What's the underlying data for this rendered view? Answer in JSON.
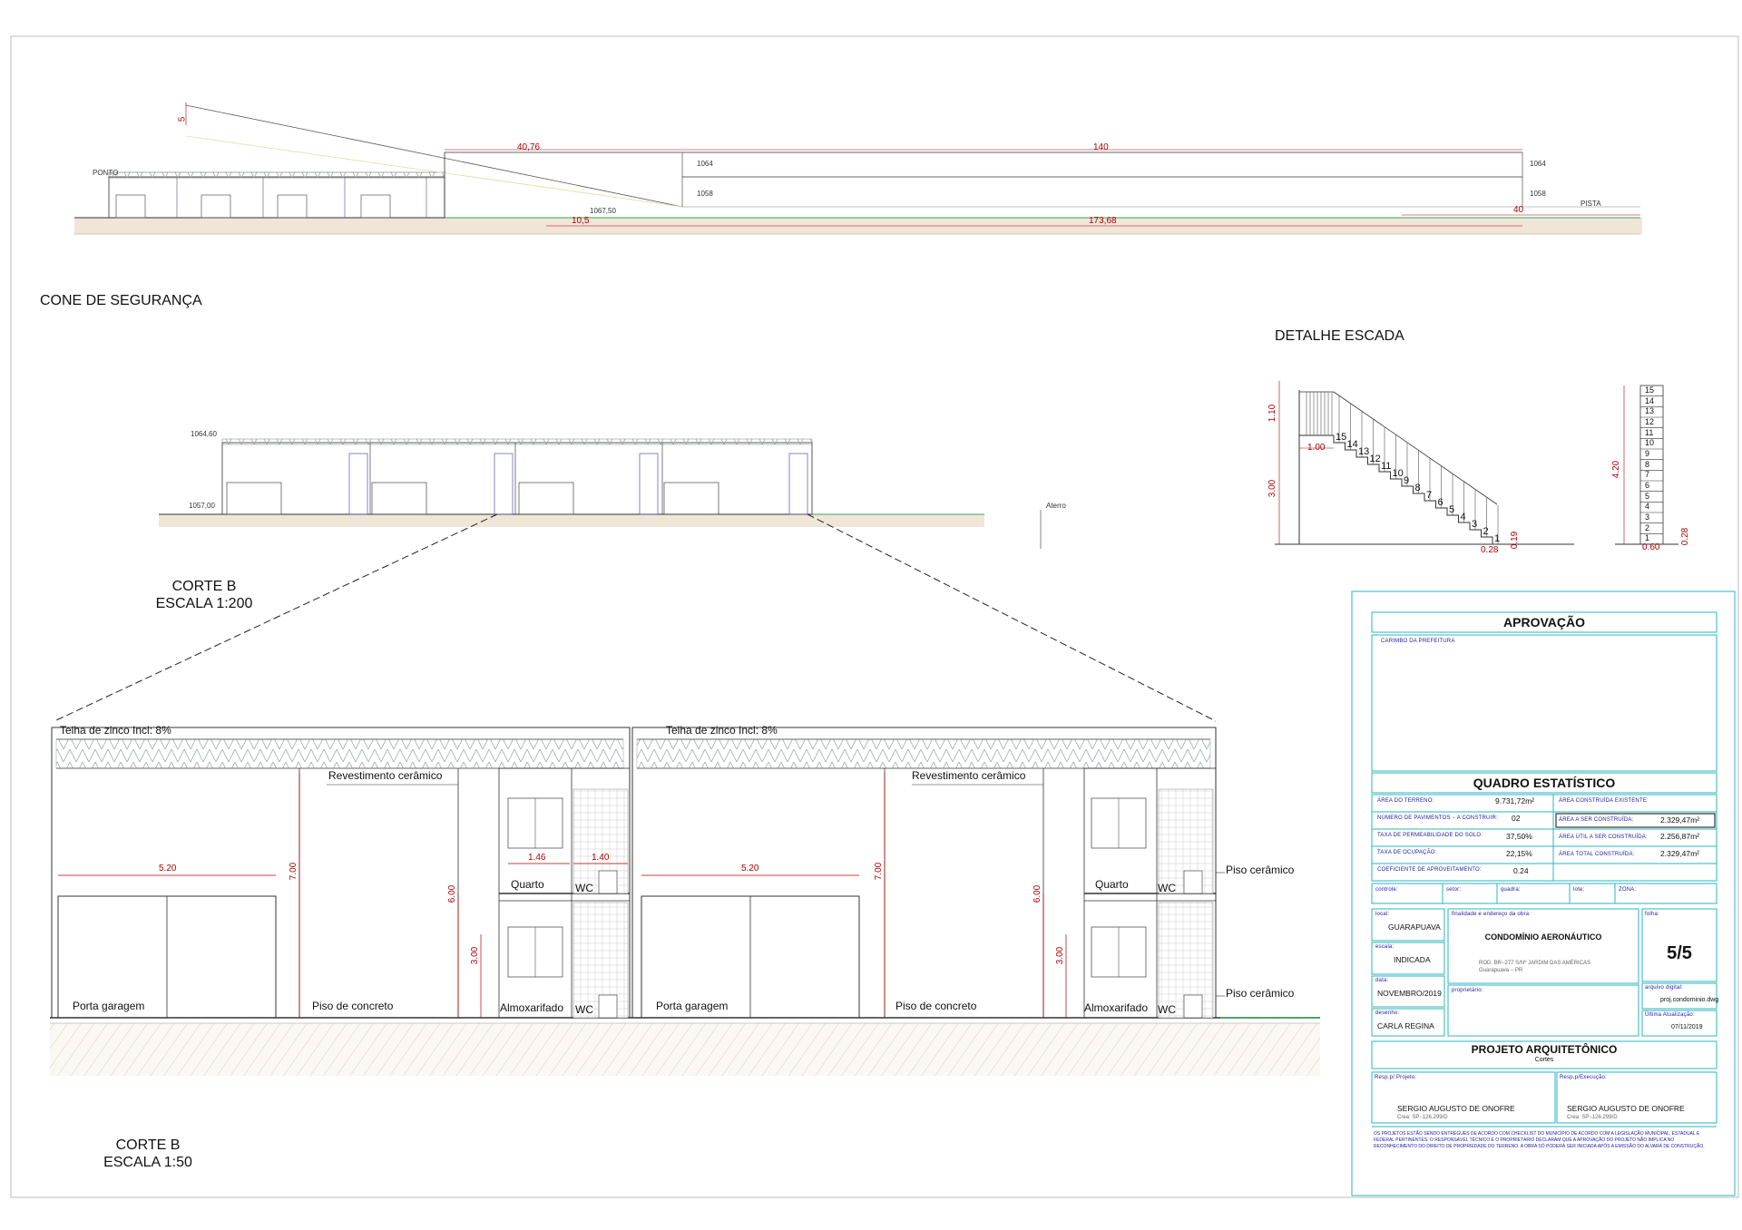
{
  "drawing": {
    "cone": {
      "title": "CONE DE SEGURANÇA",
      "dims": [
        "5",
        "40,76",
        "140",
        "10,5",
        "173,68",
        "40"
      ],
      "levels": [
        "1064",
        "1064",
        "1058",
        "1058"
      ],
      "marks": [
        "PISTA",
        "PONTO",
        "1067,50"
      ]
    },
    "corte_small": {
      "title": "CORTE B",
      "scale": "ESCALA 1:200",
      "levels": [
        "1064,60",
        "1057,00"
      ],
      "mark": "Aterro"
    },
    "escada": {
      "title": "DETALHE ESCADA",
      "dims": [
        "1.10",
        "1.00",
        "3.00",
        "0.28",
        "0.19",
        "4.20",
        "0.60",
        "0.28"
      ],
      "steps": [
        "15",
        "14",
        "13",
        "12",
        "11",
        "10",
        "9",
        "8",
        "7",
        "6",
        "5",
        "4",
        "3",
        "2",
        "1"
      ]
    },
    "corte_large": {
      "title": "CORTE B",
      "scale": "ESCALA 1:50",
      "roof_label": "Telha de zinco Incl: 8%",
      "revest": "Revestimento cerâmico",
      "piso_ceramico": "Piso cerâmico",
      "dims": {
        "w520": "5.20",
        "h700": "7.00",
        "h600": "6.00",
        "h300": "3.00",
        "w146": "1.46",
        "w140": "1.40"
      },
      "rooms": {
        "quarto": "Quarto",
        "wc": "WC",
        "almox": "Almoxarifado",
        "porta": "Porta garagem",
        "piso": "Piso de concreto"
      }
    }
  },
  "title_block": {
    "aprovacao": "APROVAÇÃO",
    "carimbo": "CARIMBO DA PREFEITURA",
    "quadro": "QUADRO ESTATÍSTICO",
    "stats_left": [
      {
        "label": "ÁREA DO TERRENO:",
        "value": "9.731,72m²"
      },
      {
        "label": "NÚMERO DE PAVIMENTOS − A CONSTRUIR:",
        "value": "02"
      },
      {
        "label": "TAXA DE PERMEABILIDADE DO SOLO:",
        "value": "37,50%"
      },
      {
        "label": "TAXA DE OCUPAÇÃO:",
        "value": "22,15%"
      },
      {
        "label": "COEFICIENTE DE APROVEITAMENTO:",
        "value": "0.24"
      }
    ],
    "stats_right": [
      {
        "label": "ÁREA CONSTRUÍDA EXISTENTE:",
        "value": ""
      },
      {
        "label": "ÁREA A SER CONSTRUÍDA:",
        "value": "2.329,47m²"
      },
      {
        "label": "ÁREA ÚTIL A SER CONSTRUÍDA:",
        "value": "2.256,87m²"
      },
      {
        "label": "ÁREA TOTAL CONSTRUÍDA:",
        "value": "2.329,47m²"
      }
    ],
    "codes": [
      "controle:",
      "setor:",
      "quadra:",
      "lote:",
      "ZONA:"
    ],
    "local_label": "local:",
    "local": "GUARAPUAVA",
    "escala_label": "escala:",
    "escala": "INDICADA",
    "data_label": "data:",
    "data": "NOVEMBRO/2019",
    "desenho_label": "desenho:",
    "desenho": "CARLA REGINA",
    "finalidade_label": "finalidade e endereço da obra:",
    "obra": "CONDOMÍNIO AERONÁUTICO",
    "endereco1": "ROD. BR−277 S/Nº JARDIM DAS AMÉRICAS",
    "endereco2": "Guarapuava − PR",
    "proprietario_label": "proprietário:",
    "folha_label": "folha:",
    "folha": "5/5",
    "arquivo_label": "arquivo digital:",
    "arquivo": "proj.condominio.dwg",
    "atualizacao_label": "Última Atualização:",
    "atualizacao": "07/11/2019",
    "projeto": "PROJETO ARQUITETÔNICO",
    "projeto_sub": "Cortes",
    "resp_projeto_label": "Resp.p/ Projeto:",
    "resp_projeto": "SERGIO AUGUSTO DE ONOFRE",
    "resp_projeto_crea": "Crea: SP−126.299/D",
    "resp_exec_label": "Resp.p/Execução:",
    "resp_exec": "SERGIO AUGUSTO DE ONOFRE",
    "resp_exec_crea": "Crea: SP−126.299/D",
    "footer": "OS PROJETOS ESTÃO SENDO ENTREGUES DE ACORDO COM CHECKLIST DO MUNICÍPIO DE ACORDO COM A LEGISLAÇÃO MUNICIPAL, ESTADUAL E FEDERAL PERTINENTES. O RESPONSÁVEL TÉCNICO E O PROPRIETÁRIO DECLARAM QUE A APROVAÇÃO DO PROJETO NÃO IMPLICA NO RECONHECIMENTO DO DIREITO DE PROPRIEDADE DO TERRENO. A OBRA SÓ PODERÁ SER INICIADA APÓS A EMISSÃO DO ALVARÁ DE CONSTRUÇÃO."
  },
  "colors": {
    "line": "#222222",
    "dim": "#b00000",
    "cyan": "#2ab5c0",
    "ground": "#e8dccb",
    "green": "#3aa55a",
    "blue": "#1a1aa0"
  }
}
